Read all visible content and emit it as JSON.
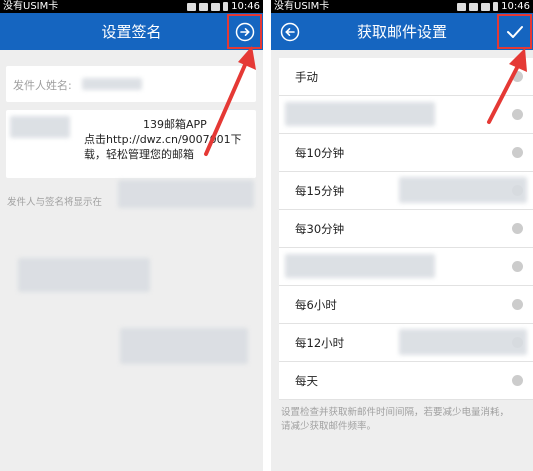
{
  "status": {
    "carrier": "没有USIM卡",
    "time": "10:46"
  },
  "left": {
    "title": "设置签名",
    "name_label": "发件人姓名:",
    "signature_lines": [
      "139邮箱APP",
      "点击http://dwz.cn/9007001下",
      "载，轻松管理您的邮箱"
    ],
    "hint": "发件人与签名将显示在"
  },
  "right": {
    "title": "获取邮件设置",
    "options": [
      "手动",
      "",
      "每10分钟",
      "每15分钟",
      "每30分钟",
      "",
      "每6小时",
      "每12小时",
      "每天"
    ],
    "hint_lines": [
      "设置检查并获取新邮件时间间隔，若要减少电量消耗，",
      "请减少获取邮件频率。"
    ]
  },
  "colors": {
    "appbar": "#1565c0",
    "highlight": "#e53935",
    "background": "#eeeeee"
  },
  "icons": {
    "left_action": "arrow-right-circle-icon",
    "right_back": "arrow-left-circle-icon",
    "right_action": "checkmark-icon"
  }
}
